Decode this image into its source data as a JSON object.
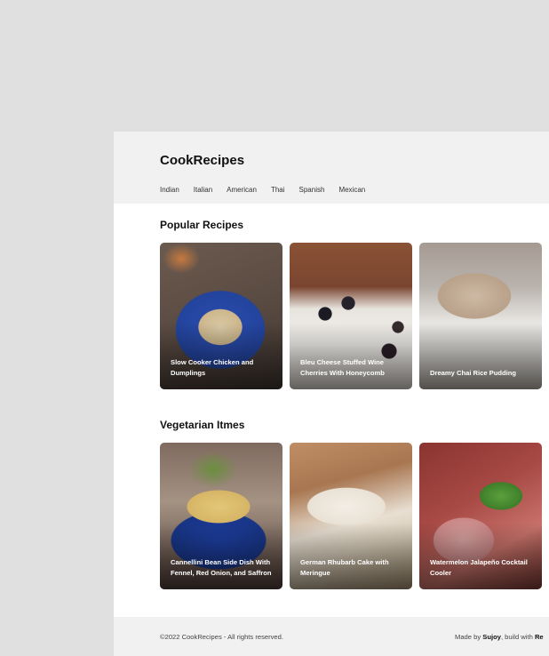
{
  "brand": "CookRecipes",
  "nav": [
    "Indian",
    "Italian",
    "American",
    "Thai",
    "Spanish",
    "Mexican"
  ],
  "sections": {
    "popular": {
      "title": "Popular Recipes",
      "cards": [
        {
          "title": "Slow Cooker Chicken and Dumplings"
        },
        {
          "title": "Bleu Cheese Stuffed Wine Cherries With Honeycomb"
        },
        {
          "title": "Dreamy Chai Rice Pudding"
        }
      ]
    },
    "vegetarian": {
      "title": "Vegetarian Itmes",
      "cards": [
        {
          "title": "Cannellini Bean Side Dish With Fennel, Red Onion, and Saffron"
        },
        {
          "title": "German Rhubarb Cake with Meringue"
        },
        {
          "title": "Watermelon Jalapeño Cocktail Cooler"
        }
      ]
    }
  },
  "footer": {
    "copyright": "©2022 CookRecipes - All rights reserved.",
    "made_by_prefix": "Made by ",
    "made_by_name": "Sujoy",
    "build_with_prefix": ", build with ",
    "build_with_name": "Re"
  }
}
